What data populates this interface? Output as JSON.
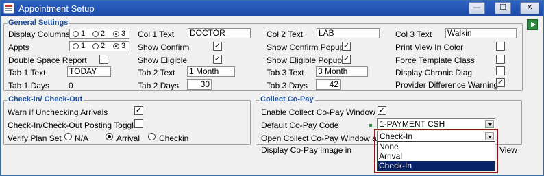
{
  "window": {
    "title": "Appointment Setup"
  },
  "title_buttons": {
    "minimize": "—",
    "maximize": "☐",
    "close": "✕"
  },
  "general": {
    "title": "General Settings",
    "display_columns_label": "Display Columns",
    "appts_label": "Appts",
    "radio_options": [
      "1",
      "2",
      "3"
    ],
    "display_columns_selected": "3",
    "appts_selected": "3",
    "double_space_label": "Double Space Report",
    "tab1_text_label": "Tab 1 Text",
    "tab1_text_value": "TODAY",
    "tab1_days_label": "Tab 1 Days",
    "tab1_days_value": "0",
    "col1_label": "Col 1 Text",
    "col1_value": "DOCTOR",
    "show_confirm_label": "Show Confirm",
    "show_eligible_label": "Show Eligible",
    "tab2_text_label": "Tab 2 Text",
    "tab2_text_value": "1 Month",
    "tab2_days_label": "Tab 2 Days",
    "tab2_days_value": "30",
    "col2_label": "Col 2 Text",
    "col2_value": "LAB",
    "show_confirm_popup_label": "Show Confirm Popup",
    "show_eligible_popup_label": "Show Eligible Popup",
    "tab3_text_label": "Tab 3 Text",
    "tab3_text_value": "3 Month",
    "tab3_days_label": "Tab 3 Days",
    "tab3_days_value": "42",
    "col3_label": "Col 3 Text",
    "col3_value": "Walkin",
    "print_view_label": "Print View In Color",
    "force_template_label": "Force Template Class",
    "display_chronic_label": "Display Chronic Diag",
    "provider_diff_label": "Provider Difference Warning"
  },
  "checkin": {
    "title": "Check-In/ Check-Out",
    "warn_label": "Warn if Unchecking Arrivals",
    "toggle_label": "Check-In/Check-Out Posting Toggle",
    "verify_label": "Verify Plan Set",
    "verify_options": [
      "N/A",
      "Arrival",
      "Checkin"
    ],
    "verify_selected": "Arrival"
  },
  "copay": {
    "title": "Collect Co-Pay",
    "enable_label": "Enable Collect Co-Pay Window",
    "default_code_label": "Default Co-Pay Code",
    "default_code_value": "1-PAYMENT CSH",
    "open_window_label": "Open Collect Co-Pay Window at",
    "open_window_value": "Check-In",
    "display_image_label": "Display Co-Pay Image in",
    "display_image_trailing": "View",
    "options": [
      "None",
      "Arrival",
      "Check-In"
    ],
    "selected_option": "Check-In"
  },
  "check_mark": "✓",
  "colors": {
    "title_bar": "#1c48a6",
    "group_title": "#1a4fa0",
    "selection": "#0a246a",
    "highlight_border": "#8b1a1a"
  }
}
